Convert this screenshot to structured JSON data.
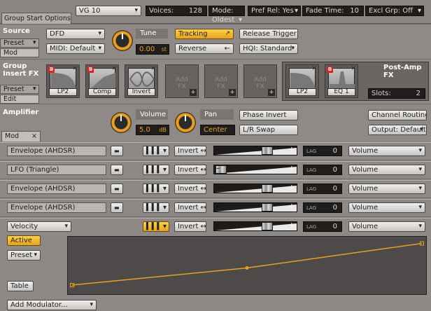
{
  "topbar": {
    "tab_label": "Group Start Options",
    "group": "VG 10",
    "voices_label": "Voices:",
    "voices_value": "128",
    "mode_label": "Mode:",
    "mode_value": "Oldest",
    "prefrel_label": "Pref Rel:",
    "prefrel_value": "Yes",
    "fade_label": "Fade Time:",
    "fade_value": "10",
    "excl_label": "Excl Grp:",
    "excl_value": "Off"
  },
  "source": {
    "title": "Source",
    "preset_label": "Preset",
    "mod_label": "Mod",
    "engine": "DFD",
    "midi": "MIDI: Default",
    "tune_label": "Tune",
    "tune_value": "0.00",
    "tune_unit": "st",
    "tracking_label": "Tracking",
    "reverse_label": "Reverse",
    "release_trigger_label": "Release Trigger",
    "hqi_label": "HQI: Standard"
  },
  "insert_fx": {
    "title_line1": "Group",
    "title_line2": "Insert FX",
    "preset_label": "Preset",
    "edit_label": "Edit",
    "slots": [
      {
        "label": "LP2",
        "badge": "B"
      },
      {
        "label": "Comp",
        "badge": "B"
      },
      {
        "label": "Invert",
        "badge": ""
      }
    ],
    "empty_slots": [
      {
        "line1": "Add",
        "line2": "FX"
      },
      {
        "line1": "Add",
        "line2": "FX"
      },
      {
        "line1": "Add",
        "line2": "FX"
      }
    ],
    "post_amp_title": "Post-Amp FX",
    "post_slots": [
      {
        "label": "LP2",
        "badge": ""
      },
      {
        "label": "EQ 1",
        "badge": "B"
      }
    ],
    "slots_label": "Slots:",
    "slots_value": "2"
  },
  "amplifier": {
    "title": "Amplifier",
    "mod_tab": "Mod",
    "volume_label": "Volume",
    "volume_value": "5.0",
    "volume_unit": "dB",
    "pan_label": "Pan",
    "pan_value": "Center",
    "phase_invert_label": "Phase Invert",
    "lr_swap_label": "L/R Swap",
    "channel_routing_label": "Channel Routing",
    "output_label": "Output: Default"
  },
  "modulators": [
    {
      "source": "Envelope (AHDSR)",
      "invert": "Invert",
      "lag_label": "LAG",
      "lag_value": "0",
      "target": "Volume",
      "amount": 0.68
    },
    {
      "source": "LFO (Triangle)",
      "invert": "Invert",
      "lag_label": "LAG",
      "lag_value": "0",
      "target": "Volume",
      "amount": 0.02
    },
    {
      "source": "Envelope (AHDSR)",
      "invert": "Invert",
      "lag_label": "LAG",
      "lag_value": "0",
      "target": "Volume",
      "amount": 0.68
    },
    {
      "source": "Envelope (AHDSR)",
      "invert": "Invert",
      "lag_label": "LAG",
      "lag_value": "0",
      "target": "Volume",
      "amount": 0.68
    }
  ],
  "velocity": {
    "source": "Velocity",
    "invert": "Invert",
    "lag_label": "LAG",
    "lag_value": "0",
    "target": "Volume",
    "amount": 0.68,
    "active_label": "Active",
    "preset_label": "Preset",
    "table_label": "Table",
    "curve_points": [
      [
        0,
        0.1
      ],
      [
        0.5,
        0.45
      ],
      [
        1,
        0.95
      ]
    ]
  },
  "footer": {
    "add_modulator_label": "Add Modulator..."
  },
  "colors": {
    "accent": "#e8a020",
    "panel": "#9c9795",
    "dark": "#1f1e1d",
    "curve": "#e8a020"
  }
}
